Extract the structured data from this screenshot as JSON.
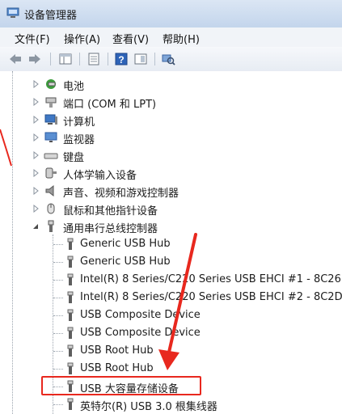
{
  "window": {
    "title": "设备管理器"
  },
  "menu": [
    "文件(F)",
    "操作(A)",
    "查看(V)",
    "帮助(H)"
  ],
  "tree": {
    "categories": [
      {
        "label": "电池",
        "icon": "battery-icon"
      },
      {
        "label": "端口 (COM 和 LPT)",
        "icon": "port-icon"
      },
      {
        "label": "计算机",
        "icon": "computer-icon"
      },
      {
        "label": "监视器",
        "icon": "monitor-icon"
      },
      {
        "label": "键盘",
        "icon": "keyboard-icon"
      },
      {
        "label": "人体学输入设备",
        "icon": "hid-icon"
      },
      {
        "label": "声音、视频和游戏控制器",
        "icon": "speaker-icon"
      },
      {
        "label": "鼠标和其他指针设备",
        "icon": "mouse-icon"
      },
      {
        "label": "通用串行总线控制器",
        "icon": "usb-icon"
      }
    ],
    "usb_children": [
      "Generic USB Hub",
      "Generic USB Hub",
      "Intel(R) 8 Series/C220 Series USB EHCI #1 - 8C26",
      "Intel(R) 8 Series/C220 Series USB EHCI #2 - 8C2D",
      "USB Composite Device",
      "USB Composite Device",
      "USB Root Hub",
      "USB Root Hub",
      "USB 大容量存储设备",
      "英特尔(R) USB 3.0 根集线器"
    ]
  },
  "colors": {
    "annotation": "#e8281e",
    "title_bar": "#c3d5ec"
  }
}
